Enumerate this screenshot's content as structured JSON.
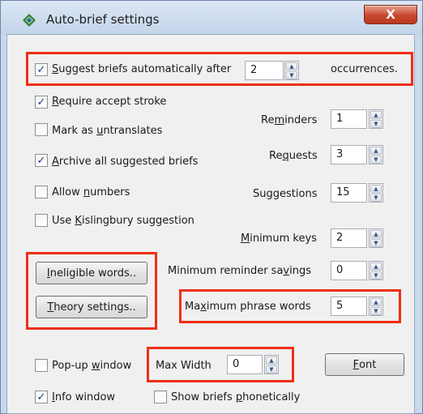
{
  "window": {
    "title": "Auto-brief settings",
    "close_glyph": "X"
  },
  "suggest": {
    "pre": "",
    "ul": "S",
    "post": "uggest briefs automatically after",
    "value": "2",
    "suffix": "occurrences.",
    "checked": true
  },
  "options": [
    {
      "pre": "",
      "ul": "R",
      "post": "equire accept stroke",
      "checked": true
    },
    {
      "pre": "Mark as ",
      "ul": "u",
      "post": "ntranslates",
      "checked": false
    },
    {
      "pre": "",
      "ul": "A",
      "post": "rchive all suggested briefs",
      "checked": true
    },
    {
      "pre": "Allow ",
      "ul": "n",
      "post": "umbers",
      "checked": false
    },
    {
      "pre": "Use ",
      "ul": "K",
      "post": "islingbury suggestion",
      "checked": false
    }
  ],
  "numerics": [
    {
      "pre": "Re",
      "ul": "m",
      "post": "inders",
      "value": "1"
    },
    {
      "pre": "Re",
      "ul": "q",
      "post": "uests",
      "value": "3"
    },
    {
      "pre": "Su",
      "ul": "g",
      "post": "gestions",
      "value": "15"
    },
    {
      "pre": "",
      "ul": "M",
      "post": "inimum keys",
      "value": "2"
    },
    {
      "pre": "Minimum reminder sa",
      "ul": "v",
      "post": "ings",
      "value": "0"
    },
    {
      "pre": "Ma",
      "ul": "x",
      "post": "imum phrase words",
      "value": "5"
    }
  ],
  "buttons": {
    "ineligible": {
      "pre": "",
      "ul": "I",
      "post": "neligible words.."
    },
    "theory": {
      "pre": "",
      "ul": "T",
      "post": "heory settings.."
    },
    "font": {
      "pre": "",
      "ul": "F",
      "post": "ont"
    }
  },
  "popup": {
    "pre": "Pop-up ",
    "ul": "w",
    "post": "indow",
    "checked": false
  },
  "max_width": {
    "label": "Max Width",
    "value": "0"
  },
  "info": {
    "pre": "",
    "ul": "I",
    "post": "nfo window",
    "checked": true
  },
  "phonetic": {
    "pre": "Show briefs ",
    "ul": "p",
    "post": "honetically",
    "checked": false
  },
  "colors": {
    "highlight": "#ee2e16",
    "title_bar": "#c9d9ec",
    "close": "#c7472d"
  }
}
